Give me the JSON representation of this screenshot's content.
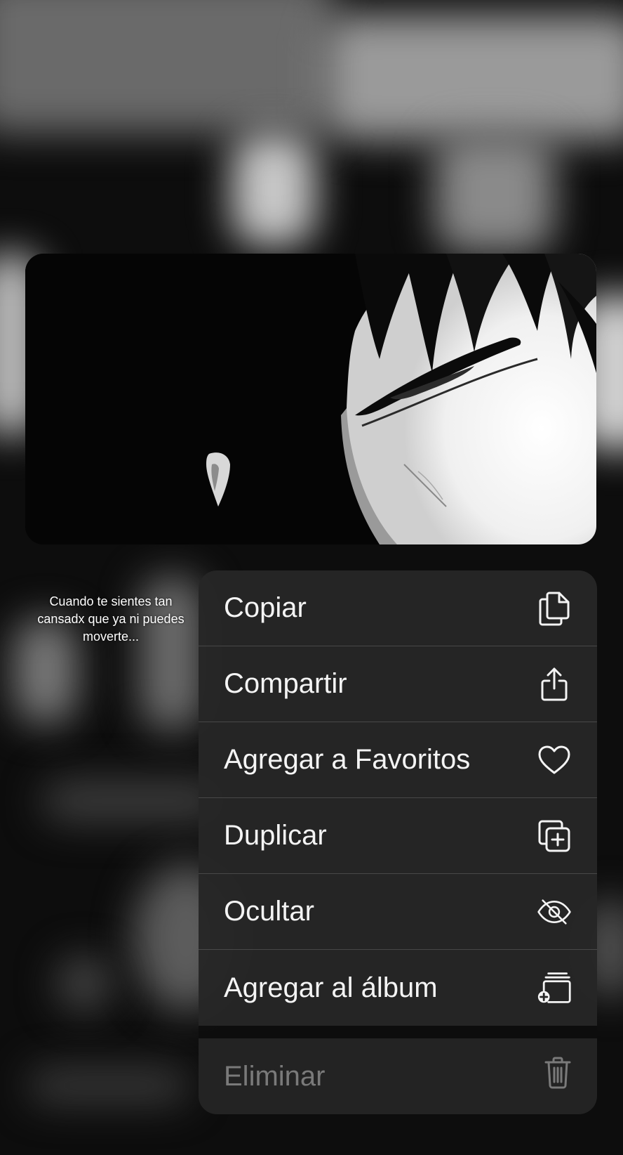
{
  "caption": {
    "line1": "Cuando te sientes tan",
    "line2": "cansadx que ya ni puedes",
    "line3": "moverte..."
  },
  "menu": {
    "items": [
      {
        "label": "Copiar",
        "icon": "copy-icon"
      },
      {
        "label": "Compartir",
        "icon": "share-icon"
      },
      {
        "label": "Agregar a Favoritos",
        "icon": "heart-icon"
      },
      {
        "label": "Duplicar",
        "icon": "duplicate-icon"
      },
      {
        "label": "Ocultar",
        "icon": "eye-slash-icon"
      },
      {
        "label": "Agregar al álbum",
        "icon": "add-to-album-icon"
      }
    ],
    "delete": {
      "label": "Eliminar",
      "icon": "trash-icon",
      "enabled": false
    }
  },
  "colors": {
    "menu_bg": "#262626",
    "menu_text": "#f4f4f4",
    "disabled_text": "#7a7a7a"
  }
}
